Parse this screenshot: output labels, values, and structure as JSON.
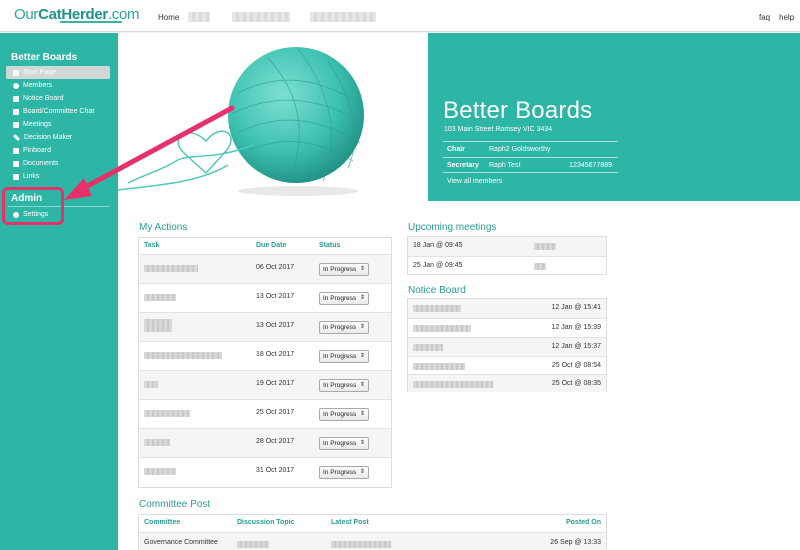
{
  "header": {
    "logo_light": "Our",
    "logo_bold": "CatHerder",
    "logo_tld": ".com",
    "nav_home": "Home",
    "faq": "faq",
    "help": "help"
  },
  "sidebar": {
    "title": "Better Boards",
    "items": [
      {
        "label": "Start Page",
        "icon": "home-icon"
      },
      {
        "label": "Members",
        "icon": "user-icon"
      },
      {
        "label": "Notice Board",
        "icon": "pin-icon"
      },
      {
        "label": "Board/Committee Chat",
        "icon": "chat-icon"
      },
      {
        "label": "Meetings",
        "icon": "calendar-icon"
      },
      {
        "label": "Decision Maker",
        "icon": "pencil-icon"
      },
      {
        "label": "Pinboard",
        "icon": "grid-icon"
      },
      {
        "label": "Documents",
        "icon": "document-icon"
      },
      {
        "label": "Links",
        "icon": "link-icon"
      }
    ],
    "admin_title": "Admin",
    "admin_items": [
      {
        "label": "Settings",
        "icon": "gear-icon"
      }
    ]
  },
  "org": {
    "name": "Better Boards",
    "address": "103 Main Street Romsey VIC 3434",
    "chair_label": "Chair",
    "chair_name": "Raph2 Goldsworthy",
    "secretary_label": "Secretary",
    "secretary_name": "Raph Test",
    "secretary_phone": "12345677889",
    "view_all": "View all members"
  },
  "my_actions": {
    "title": "My Actions",
    "columns": [
      "Task",
      "Due Date",
      "Status"
    ],
    "rows": [
      {
        "due": "06 Oct 2017",
        "status": "In Progress"
      },
      {
        "due": "13 Oct 2017",
        "status": "In Progress"
      },
      {
        "due": "13 Oct 2017",
        "status": "In Progress"
      },
      {
        "due": "18 Oct 2017",
        "status": "In Progress"
      },
      {
        "due": "19 Oct 2017",
        "status": "In Progress"
      },
      {
        "due": "25 Oct 2017",
        "status": "In Progress"
      },
      {
        "due": "28 Oct 2017",
        "status": "In Progress"
      },
      {
        "due": "31 Oct 2017",
        "status": "In Progress"
      }
    ]
  },
  "upcoming_meetings": {
    "title": "Upcoming meetings",
    "rows": [
      {
        "when": "18 Jan @ 09:45"
      },
      {
        "when": "25 Jan @ 09:45"
      }
    ]
  },
  "notice_board": {
    "title": "Notice Board",
    "rows": [
      {
        "when": "12 Jan @ 15:41"
      },
      {
        "when": "12 Jan @ 15:39"
      },
      {
        "when": "12 Jan @ 15:37"
      },
      {
        "when": "25 Oct @ 08:54"
      },
      {
        "when": "25 Oct @ 08:35"
      }
    ]
  },
  "committee_post": {
    "title": "Committee Post",
    "columns": [
      "Committee",
      "Discussion Topic",
      "Latest Post",
      "Posted On"
    ],
    "rows": [
      {
        "committee": "Governance Committee",
        "posted_on": "26 Sep @ 13:33"
      }
    ]
  },
  "colors": {
    "teal": "#2db5a6",
    "accent_pink": "#e8306b"
  }
}
